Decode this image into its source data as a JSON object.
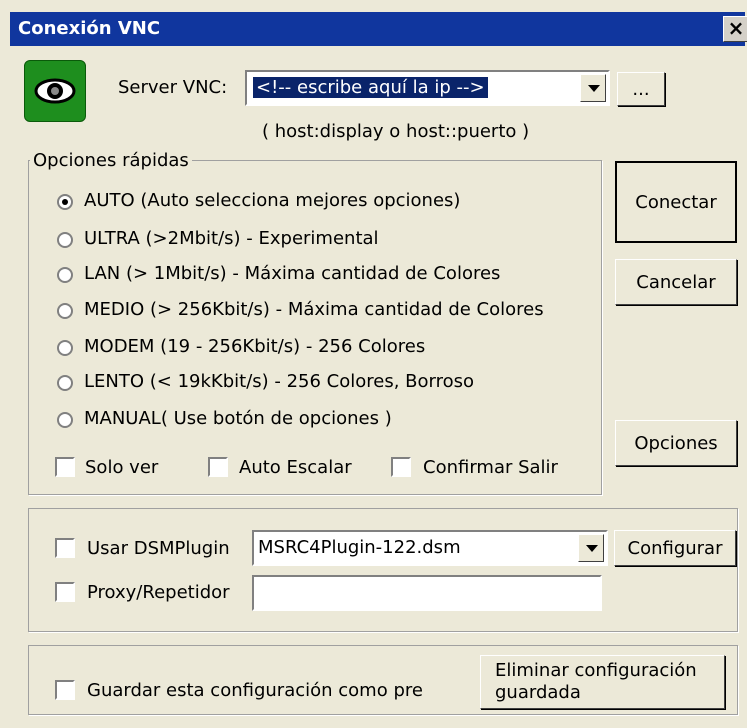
{
  "window": {
    "title": "Conexión VNC"
  },
  "server": {
    "label": "Server VNC:",
    "value": "<!-- escribe aquí la ip -->",
    "hint": "( host:display o host::puerto )",
    "browse_label": "..."
  },
  "quick_options": {
    "legend": "Opciones rápidas",
    "options": [
      {
        "label": "AUTO (Auto selecciona mejores opciones)",
        "selected": true
      },
      {
        "label": "ULTRA (>2Mbit/s) - Experimental",
        "selected": false
      },
      {
        "label": "LAN (> 1Mbit/s) - Máxima cantidad de Colores",
        "selected": false
      },
      {
        "label": "MEDIO (> 256Kbit/s) - Máxima cantidad de Colores",
        "selected": false
      },
      {
        "label": "MODEM (19 - 256Kbit/s) - 256 Colores",
        "selected": false
      },
      {
        "label": "LENTO (< 19kKbit/s) - 256 Colores, Borroso",
        "selected": false
      },
      {
        "label": "MANUAL( Use botón de opciones )",
        "selected": false
      }
    ],
    "checkboxes": [
      {
        "label": "Solo ver",
        "checked": false
      },
      {
        "label": "Auto Escalar",
        "checked": false
      },
      {
        "label": "Confirmar Salir",
        "checked": false
      }
    ]
  },
  "buttons": {
    "connect": "Conectar",
    "cancel": "Cancelar",
    "options": "Opciones",
    "configure": "Configurar"
  },
  "dsm": {
    "checkbox_label": "Usar DSMPlugin",
    "plugin_value": "MSRC4Plugin-122.dsm",
    "proxy_label": "Proxy/Repetidor",
    "proxy_value": ""
  },
  "save": {
    "checkbox_label": "Guardar esta configuración como pre",
    "delete_line1": "Eliminar configuración",
    "delete_line2": "guardada"
  },
  "colors": {
    "titlebar": "#10369e",
    "highlight": "#0a246a",
    "icon_green": "#1e8e1e"
  }
}
